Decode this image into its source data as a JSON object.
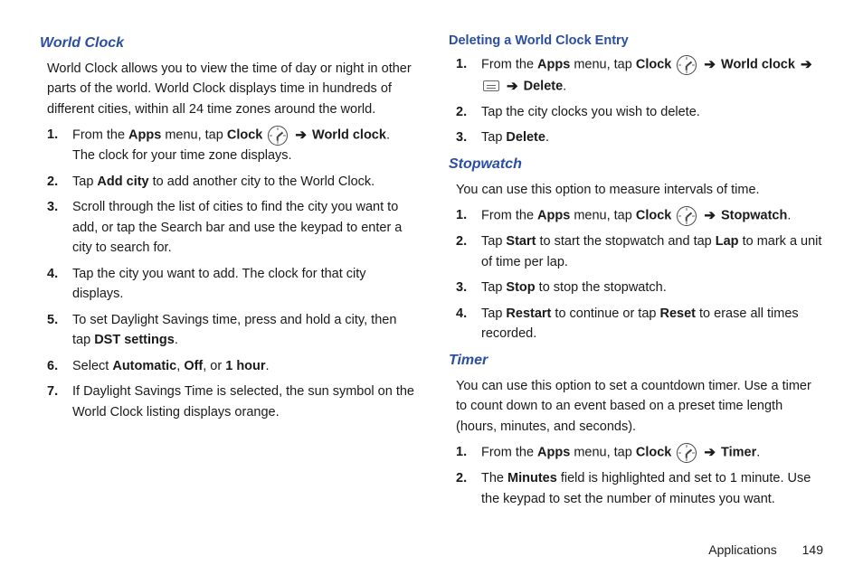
{
  "left": {
    "worldClock": {
      "heading": "World Clock",
      "intro": "World Clock allows you to view the time of day or night in other parts of the world. World Clock displays time in hundreds of different cities, within all 24 time zones around the world.",
      "step1_a": "From the ",
      "step1_apps": "Apps",
      "step1_b": " menu, tap ",
      "step1_clock": "Clock",
      "step1_c": " ",
      "step1_worldclock": "World clock",
      "step1_d": ". The clock for your time zone displays.",
      "step2_a": "Tap ",
      "step2_addcity": "Add city",
      "step2_b": " to add another city to the World Clock.",
      "step3": "Scroll through the list of cities to find the city you want to add, or tap the Search bar and use the keypad to enter a city to search for.",
      "step4": "Tap the city you want to add. The clock for that city displays.",
      "step5_a": "To set Daylight Savings time, press and hold a city, then tap ",
      "step5_dst": "DST settings",
      "step5_b": ".",
      "step6_a": "Select ",
      "step6_auto": "Automatic",
      "step6_c1": ", ",
      "step6_off": "Off",
      "step6_c2": ", or ",
      "step6_1hr": "1 hour",
      "step6_b": ".",
      "step7": "If Daylight Savings Time is selected, the sun symbol on the World Clock listing displays orange."
    }
  },
  "right": {
    "deleting": {
      "heading": "Deleting a World Clock Entry",
      "step1_a": "From the ",
      "step1_apps": "Apps",
      "step1_b": " menu, tap ",
      "step1_clock": "Clock",
      "step1_worldclock": "World clock",
      "step1_delete": "Delete",
      "step1_c": ".",
      "step2": "Tap the city clocks you wish to delete.",
      "step3_a": "Tap ",
      "step3_delete": "Delete",
      "step3_b": "."
    },
    "stopwatch": {
      "heading": "Stopwatch",
      "intro": "You can use this option to measure intervals of time.",
      "step1_a": "From the ",
      "step1_apps": "Apps",
      "step1_b": " menu, tap ",
      "step1_clock": "Clock",
      "step1_sw": "Stopwatch",
      "step1_c": ".",
      "step2_a": "Tap ",
      "step2_start": "Start",
      "step2_b": " to start the stopwatch and tap ",
      "step2_lap": "Lap",
      "step2_c": " to mark a unit of time per lap.",
      "step3_a": "Tap ",
      "step3_stop": "Stop",
      "step3_b": " to stop the stopwatch.",
      "step4_a": "Tap ",
      "step4_restart": "Restart",
      "step4_b": " to continue or tap ",
      "step4_reset": "Reset",
      "step4_c": " to erase all times recorded."
    },
    "timer": {
      "heading": "Timer",
      "intro": "You can use this option to set a countdown timer. Use a timer to count down to an event based on a preset time length (hours, minutes, and seconds).",
      "step1_a": "From the ",
      "step1_apps": "Apps",
      "step1_b": " menu, tap ",
      "step1_clock": "Clock",
      "step1_timer": "Timer",
      "step1_c": ".",
      "step2_a": "The ",
      "step2_min": "Minutes",
      "step2_b": " field is highlighted and set to 1 minute. Use the keypad to set the number of minutes you want."
    }
  },
  "footer": {
    "section": "Applications",
    "page": "149"
  },
  "arrow": "➔"
}
